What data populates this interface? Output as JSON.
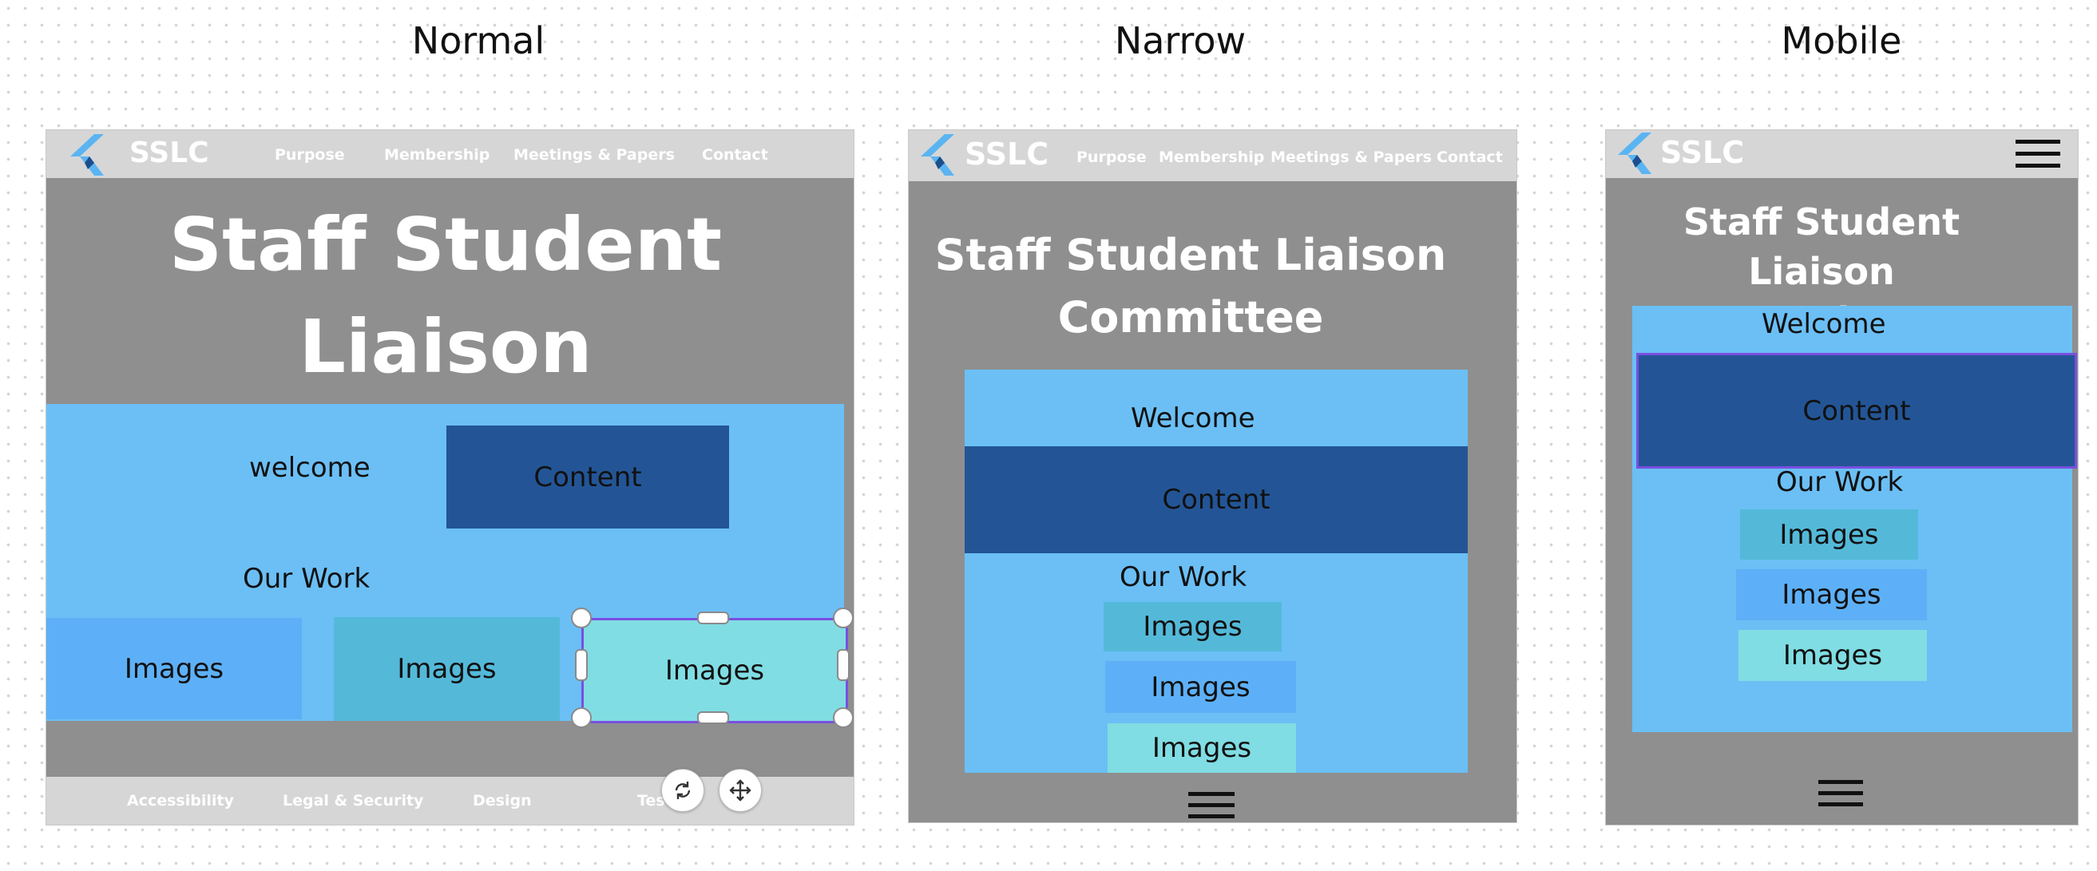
{
  "headings": {
    "normal": "Normal",
    "narrow": "Narrow",
    "mobile": "Mobile"
  },
  "brand": "SSLC",
  "nav": {
    "purpose": "Purpose",
    "membership": "Membership",
    "meetings": "Meetings & Papers",
    "contact": "Contact"
  },
  "title": {
    "line1": "Staff Student Liaison",
    "line2": "Committee"
  },
  "normal": {
    "welcome": "welcome",
    "content": "Content",
    "our_work": "Our Work",
    "images": [
      "Images",
      "Images",
      "Images"
    ],
    "footer": [
      "Accessibility",
      "Legal & Security",
      "Design",
      "Tes"
    ]
  },
  "narrow": {
    "welcome": "Welcome",
    "content": "Content",
    "our_work": "Our Work",
    "images": [
      "Images",
      "Images",
      "Images"
    ]
  },
  "mobile": {
    "welcome": "Welcome",
    "content": "Content",
    "our_work": "Our Work",
    "images": [
      "Images",
      "Images",
      "Images"
    ]
  },
  "icons": {
    "logo": "flutter-logo-icon",
    "menu": "hamburger-menu-icon",
    "rotate": "rotate-icon",
    "move": "move-icon"
  },
  "colors": {
    "canvas": "#ffffff",
    "frame_bg": "#8f8f8f",
    "navbar": "#d6d6d6",
    "light_blue": "#6bbff5",
    "dark_blue": "#235596",
    "image_blue": "#5db0f7",
    "image_teal": "#54b9d9",
    "image_cyan": "#80dde3",
    "selection": "#7a4fe0"
  }
}
